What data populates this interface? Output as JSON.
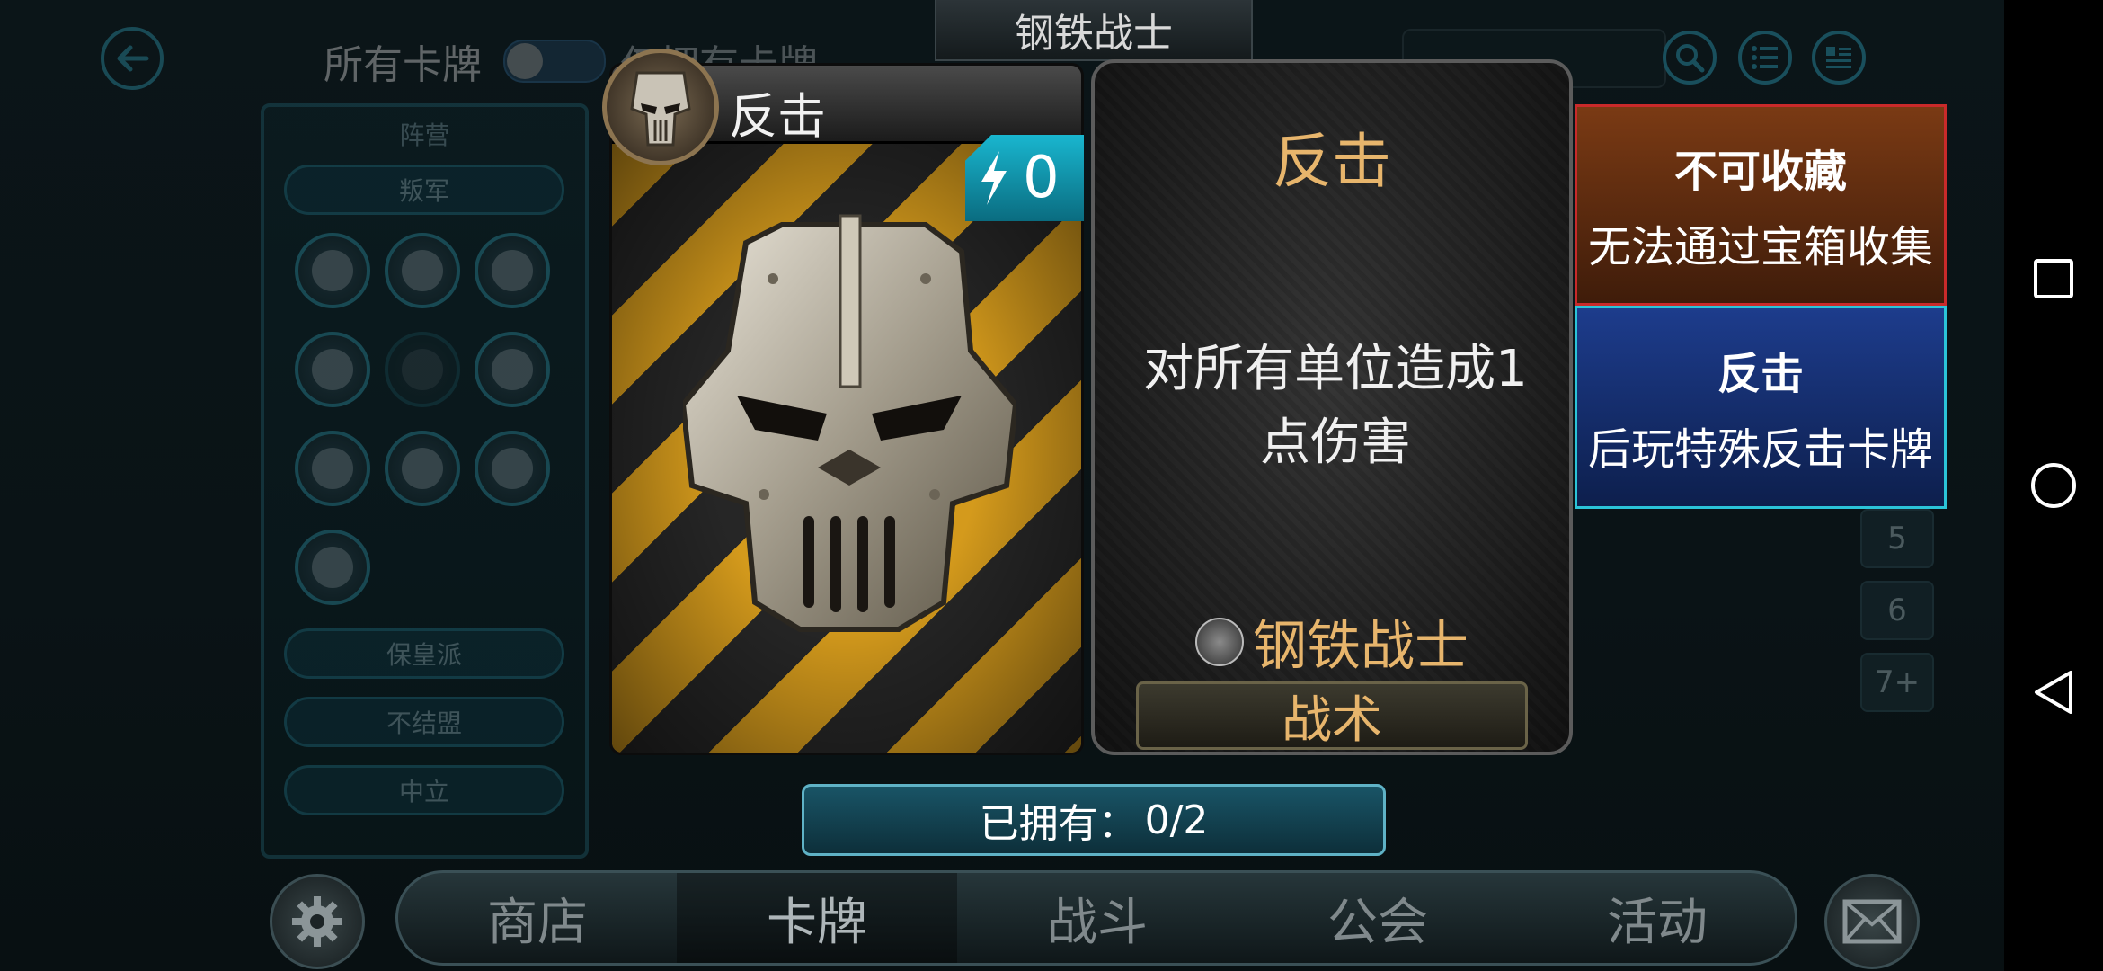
{
  "header": {
    "title": "钢铁战士",
    "all_cards_label": "所有卡牌",
    "hidden_tab_label": "仅拥有卡牌"
  },
  "filter_panel": {
    "header": "阵营",
    "factions": [
      "叛军",
      "保皇派",
      "不结盟",
      "中立"
    ]
  },
  "cost_filters": [
    "5",
    "6",
    "7+"
  ],
  "bottom_nav": {
    "tabs": [
      "商店",
      "卡牌",
      "战斗",
      "公会",
      "活动"
    ]
  },
  "card": {
    "name": "反击",
    "cost": "0",
    "description_title": "反击",
    "description": "对所有单位造成1点伤害",
    "faction_name": "钢铁战士",
    "type": "战术"
  },
  "info_boxes": {
    "not_collectible_title": "不可收藏",
    "not_collectible_text": "无法通过宝箱收集",
    "counter_title": "反击",
    "counter_text": "后玩特殊反击卡牌"
  },
  "owned": {
    "label": "已拥有：",
    "value": "0/2"
  },
  "colors": {
    "accent_cyan": "#2bc4d8",
    "gold_text": "#e7b56c",
    "red_border": "#c92a2a",
    "blue_box": "#1d3c8c"
  },
  "icons": {
    "back": "arrow-left-icon",
    "search": "search-icon",
    "list": "list-icon",
    "sort": "sort-icon",
    "settings": "gear-icon",
    "mail": "mail-icon",
    "energy": "lightning-icon"
  }
}
